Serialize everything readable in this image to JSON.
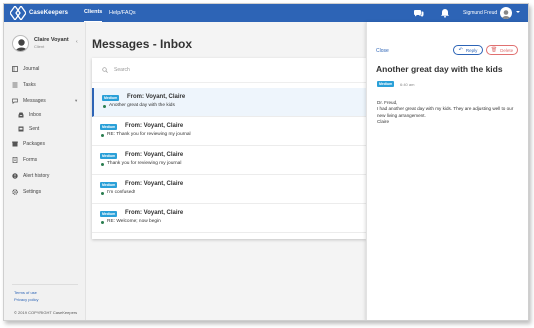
{
  "app": {
    "brand": "CaseKeepers",
    "nav": [
      {
        "label": "Clients"
      },
      {
        "label": "Help/FAQs"
      }
    ],
    "user_name": "Sigmund Freud"
  },
  "sidebar": {
    "profile": {
      "name": "Claire Voyant",
      "role": "Client"
    },
    "items": [
      {
        "label": "Journal",
        "icon": "book-icon"
      },
      {
        "label": "Tasks",
        "icon": "list-icon"
      },
      {
        "label": "Messages",
        "icon": "chat-icon"
      },
      {
        "label": "Inbox",
        "icon": "inbox-icon"
      },
      {
        "label": "Sent",
        "icon": "sent-icon"
      },
      {
        "label": "Packages",
        "icon": "package-icon"
      },
      {
        "label": "Forms",
        "icon": "forms-icon"
      },
      {
        "label": "Alert history",
        "icon": "alert-icon"
      },
      {
        "label": "Settings",
        "icon": "gear-icon"
      }
    ],
    "footer": {
      "terms": "Terms of use",
      "privacy": "Privacy policy",
      "copyright": "© 2019 COPYRIGHT CaseKeepers"
    }
  },
  "main": {
    "title": "Messages - Inbox",
    "search": {
      "placeholder": "Search",
      "value": ""
    },
    "messages": [
      {
        "badge": "Medium",
        "from": "From: Voyant, Claire",
        "subject": "Another great day with the kids",
        "selected": true
      },
      {
        "badge": "Medium",
        "from": "From: Voyant, Claire",
        "subject": "RE: Thank you for reviewing my journal",
        "selected": false
      },
      {
        "badge": "Medium",
        "from": "From: Voyant, Claire",
        "subject": "Thank you for reviewing my journal",
        "selected": false
      },
      {
        "badge": "Medium",
        "from": "From: Voyant, Claire",
        "subject": "I'm confused!",
        "selected": false
      },
      {
        "badge": "Medium",
        "from": "From: Voyant, Claire",
        "subject": "RE: Welcome; now begin",
        "selected": false
      }
    ]
  },
  "detail": {
    "close_label": "Close",
    "reply_label": "Reply",
    "delete_label": "Delete",
    "title": "Another great day with the kids",
    "badge": "Medium",
    "time": "6:40 am",
    "body": [
      "Dr. Freud,",
      "I had another great day with my kids. They are adjusting well to our new living arrangement.",
      "Claire"
    ]
  },
  "colors": {
    "brand_blue": "#2d64b6",
    "badge_blue": "#2aa0d8",
    "delete_red": "#e07070",
    "unread_dot": "#2a7d4f"
  }
}
